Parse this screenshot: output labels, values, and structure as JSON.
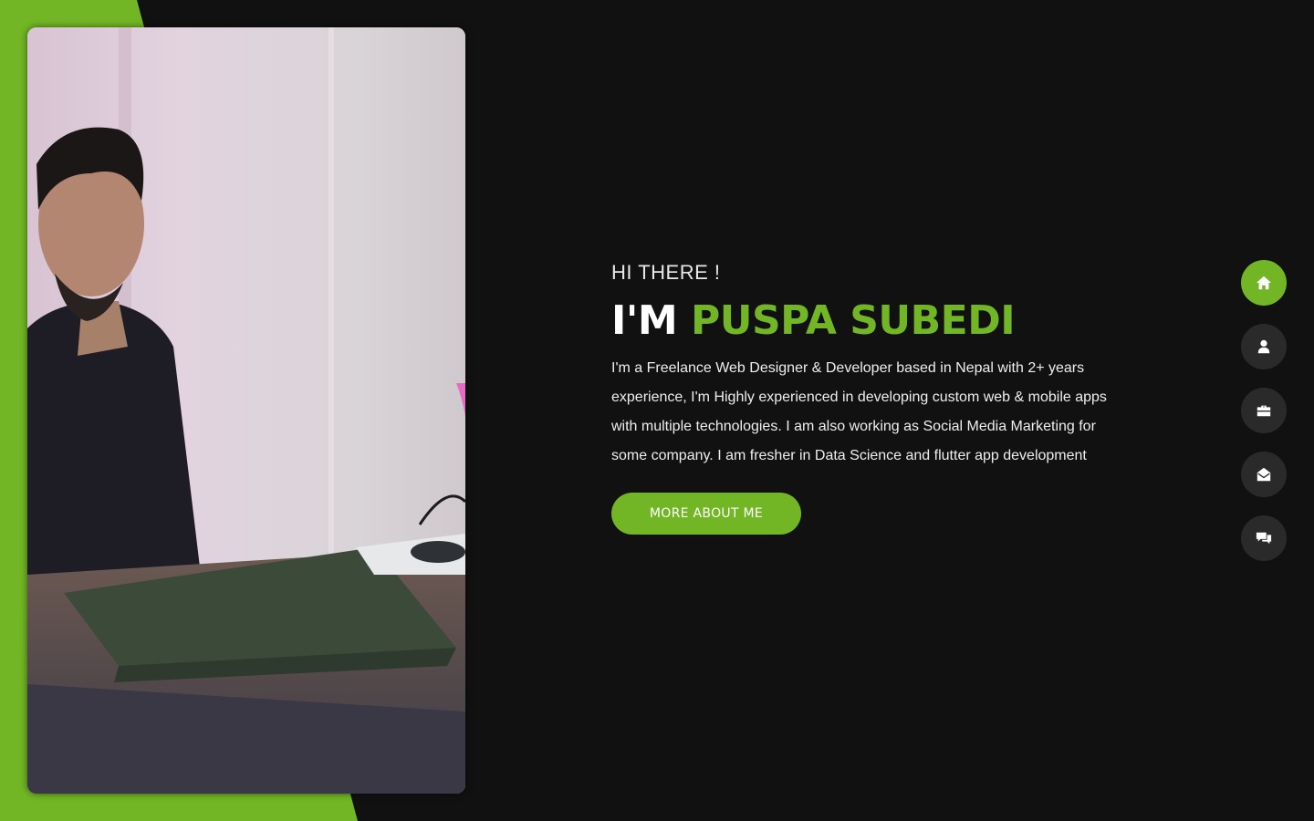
{
  "colors": {
    "accent": "#72b626",
    "background": "#111111",
    "nav_inactive": "#2b2a2a",
    "text": "#ffffff"
  },
  "hero": {
    "greeting": "HI THERE !",
    "headline_prefix": "I'M",
    "name": "PUSPA SUBEDI",
    "bio": "I'm a Freelance Web Designer & Developer based in Nepal with 2+ years experience, I'm Highly experienced in developing custom web & mobile apps with multiple technologies. I am also working as Social Media Marketing for some company. I am fresher in Data Science and flutter app development",
    "cta_label": "MORE ABOUT ME"
  },
  "nav": {
    "items": [
      {
        "icon": "home-icon",
        "active": true
      },
      {
        "icon": "user-icon",
        "active": false
      },
      {
        "icon": "briefcase-icon",
        "active": false
      },
      {
        "icon": "envelope-open-icon",
        "active": false
      },
      {
        "icon": "comments-icon",
        "active": false
      }
    ]
  },
  "profile_photo": {
    "icon": "profile-photo"
  }
}
